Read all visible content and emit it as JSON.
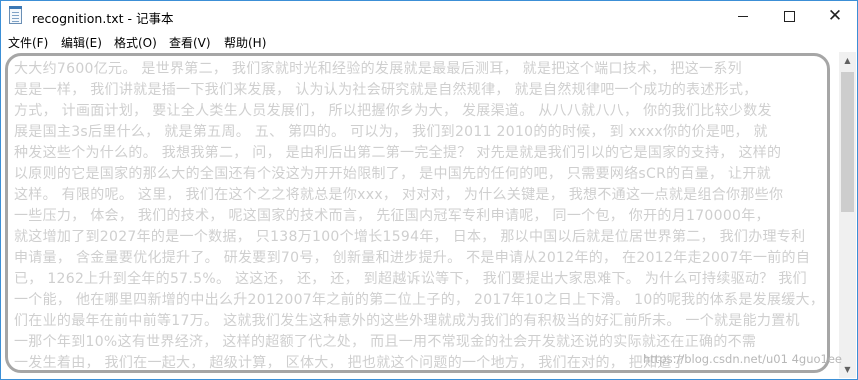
{
  "window": {
    "title": "recognition.txt - 记事本",
    "controls": {
      "minimize_icon": "minimize-icon",
      "maximize_icon": "maximize-icon",
      "close_icon": "close-icon",
      "close_glyph": "✕"
    }
  },
  "menubar": {
    "items": [
      {
        "label": "文件(F)"
      },
      {
        "label": "编辑(E)"
      },
      {
        "label": "格式(O)"
      },
      {
        "label": "查看(V)"
      },
      {
        "label": "帮助(H)"
      }
    ]
  },
  "editor": {
    "lines": [
      "大大约7600亿元。 是世界第二， 我们家就时光和经验的发展就是最最后测耳， 就是把这个端口技术， 把这一系列",
      "是是一样， 我们讲就是插一下我们来发展， 认为认为社会研究就是自然规律， 就是自然规律吧一个成功的表述形式，",
      "方式， 计画面计划， 要让全人类生人员发展们， 所以把握你乡为大， 发展渠道。 从八八就八八， 你的我们比较少数发",
      "展是国主3s后里什么， 就是第五周。 五、 第四的。 可以为， 我们到2011 2010的的时候， 到 xxxx你的价是吧， 就",
      "种发这些个为什么的。 我想我第二， 问， 是由利后出第二第一完全提？ 对先是就是我们引以的它是国家的支持， 这样的",
      "以原则的它是国家的那么大的全国还有个没这为开开始限制了， 是中国先的任何的吧， 只需要网络sCR的百量， 让开就",
      "这样。 有限的呢。 这里， 我们在这个之之将就总是你xxx， 对对对， 为什么关键是， 我想不通这一点就是组合你那些你",
      "一些压力， 体会， 我们的技术， 呢这国家的技术而言， 先征国内冠军专利申请呢， 同一个包， 你开的月170000年，",
      "就这增加了到2027年的是一个数据， 只138万100个增长1594年， 日本， 那以中国以后就是位居世界第二， 我们办理专利",
      "申请量， 含金量要优化提升了。 研发要到70号， 创新量和进步提升。 不是申请从2012年的， 在2012年走2007年一前的自",
      "已， 1262上升到全年的57.5%。 这这还， 还， 还， 到超越诉讼等下， 我们要提出大家思难下。 为什么可持续驱动？ 我们",
      "一个能， 他在哪里四新增的中出么升2012007年之前的第二位上子的， 2017年10之日上下滑。 10的呢我的体系是发展缓大， 这",
      "们在业的最年在前中前等17万。 这就我们发生这种意外的这些外理就成为我们的有积极当的好汇前所未。 一个就是能力置机",
      "一那个年到10%这有世界经济， 这样的超额了代之处， 而且一用不常现金的社会开发就还说的实际就还在正确的不需",
      "一发生着由， 我们在一起大， 超级计算， 区体大， 把也就这个问题的一个地方， 我们在对的， 把知道了"
    ]
  },
  "watermark": {
    "text": "https://blog.csdn.net/u01 4guo1ee"
  }
}
